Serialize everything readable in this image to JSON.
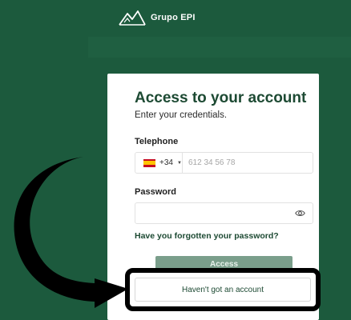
{
  "brand": {
    "name": "Grupo EPI",
    "logo_icon": "mountain-logo-icon"
  },
  "card": {
    "title": "Access to your account",
    "subtitle": "Enter your credentials.",
    "telephone_label": "Telephone",
    "country_code": "+34",
    "country_flag": "spain-flag-icon",
    "phone_placeholder": "612 34 56 78",
    "password_label": "Password",
    "password_placeholder": "",
    "forgot_link": "Have you forgotten your password?",
    "access_button": "Access",
    "no_account_button": "Haven't got an account"
  },
  "colors": {
    "background": "#1c5a3d",
    "primary_text": "#1d4a33",
    "access_button": "#7a9e8b",
    "highlight_border": "#000000"
  }
}
